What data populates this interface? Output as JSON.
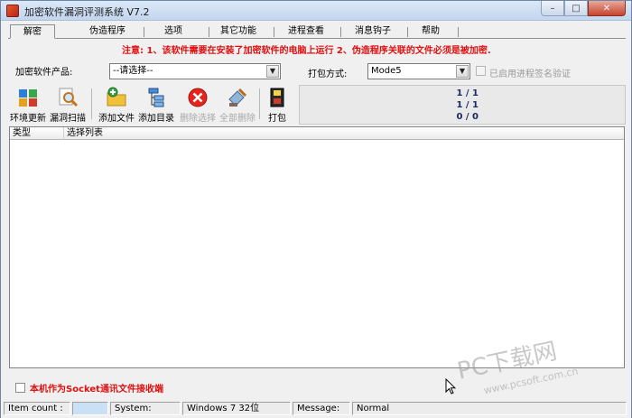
{
  "window": {
    "title": "加密软件漏洞评测系统  V7.2",
    "controls": [
      "–",
      "□",
      "✕"
    ]
  },
  "tabs": [
    {
      "label": "解密",
      "active": true
    },
    {
      "label": "伪造程序",
      "active": false
    },
    {
      "label": "选项",
      "active": false
    },
    {
      "label": "其它功能",
      "active": false
    },
    {
      "label": "进程查看",
      "active": false
    },
    {
      "label": "消息钩子",
      "active": false
    },
    {
      "label": "帮助",
      "active": false
    }
  ],
  "notice": "注意: 1、该软件需要在安装了加密软件的电脑上运行   2、伪造程序关联的文件必须是被加密.",
  "form": {
    "product_label": "加密软件产品:",
    "product_value": "--请选择--",
    "pack_label": "打包方式:",
    "pack_value": "Mode5",
    "verify_label": "已启用进程签名验证"
  },
  "toolbar": [
    {
      "label": "环境更新",
      "icon": "environment-update-icon",
      "enabled": true
    },
    {
      "label": "漏洞扫描",
      "icon": "scan-magnifier-icon",
      "enabled": true
    },
    {
      "label": "添加文件",
      "icon": "add-file-folder-icon",
      "enabled": true
    },
    {
      "label": "添加目录",
      "icon": "add-directory-tree-icon",
      "enabled": true
    },
    {
      "label": "删除选择",
      "icon": "delete-x-icon",
      "enabled": false
    },
    {
      "label": "全部删除",
      "icon": "clear-all-broom-icon",
      "enabled": false
    },
    {
      "label": "打包",
      "icon": "package-icon",
      "enabled": true
    }
  ],
  "stats": [
    "1 / 1",
    "1 / 1",
    "0 / 0"
  ],
  "list": {
    "columns": [
      "类型",
      "选择列表"
    ],
    "rows": []
  },
  "socket_label": "本机作为Socket通讯文件接收端",
  "statusbar": {
    "item_count_label": "Item count :",
    "item_count_value": "",
    "system_label": "System:",
    "system_value": "Windows 7 32位",
    "message_label": "Message:",
    "message_value": "Normal"
  },
  "watermark": {
    "brand": "PC下载网",
    "url": "www.pcsoft.com.cn"
  },
  "colors": {
    "notice": "#e01010",
    "stats": "#1a2a66",
    "status_blue": "#c9e0f5"
  }
}
